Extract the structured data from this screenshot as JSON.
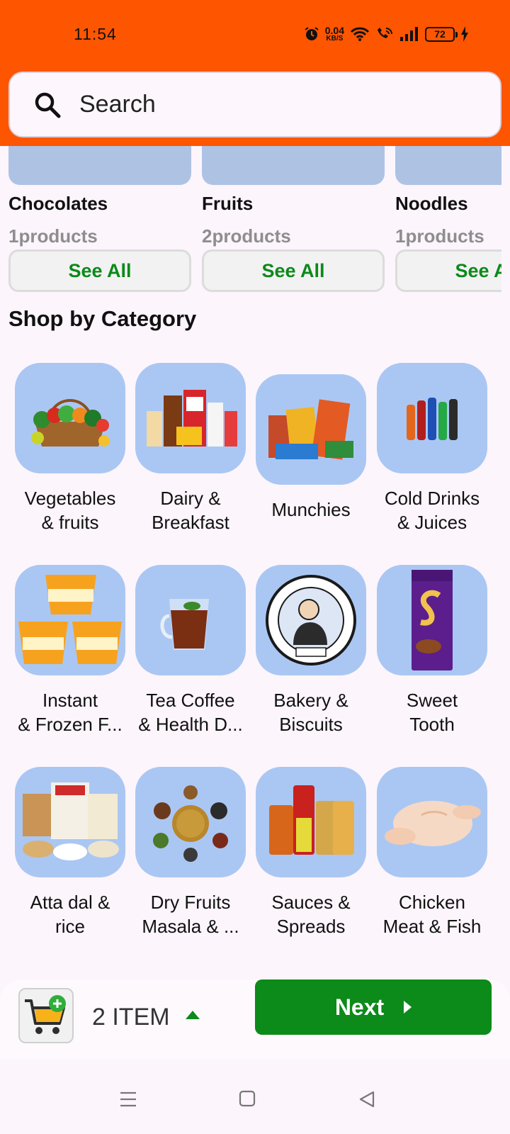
{
  "status_bar": {
    "time": "11:54",
    "net_speed_value": "0.04",
    "net_speed_unit": "KB/S",
    "battery": "72",
    "icons": [
      "alarm-icon",
      "wifi-icon",
      "wifi-call-icon",
      "signal-icon",
      "battery-icon",
      "charging-icon"
    ]
  },
  "search": {
    "placeholder": "Search"
  },
  "featured": [
    {
      "name": "Chocolates",
      "count": "1products",
      "action": "See All"
    },
    {
      "name": "Fruits",
      "count": "2products",
      "action": "See All"
    },
    {
      "name": "Noodles",
      "count": "1products",
      "action": "See All"
    }
  ],
  "section_title": "Shop by Category",
  "categories": [
    {
      "line1": "Vegetables",
      "line2": "& fruits",
      "icon": "vegetables-basket-icon"
    },
    {
      "line1": "Dairy &",
      "line2": "Breakfast",
      "icon": "dairy-products-icon"
    },
    {
      "line1": "Munchies",
      "line2": "",
      "icon": "snacks-icon"
    },
    {
      "line1": "Cold Drinks",
      "line2": "& Juices",
      "icon": "soft-drink-bottles-icon"
    },
    {
      "line1": "Instant",
      "line2": "& Frozen F...",
      "icon": "instant-noodle-cups-icon"
    },
    {
      "line1": "Tea Coffee",
      "line2": "& Health D...",
      "icon": "tea-cup-icon"
    },
    {
      "line1": "Bakery &",
      "line2": "Biscuits",
      "icon": "bakers-logo-icon"
    },
    {
      "line1": "Sweet",
      "line2": "Tooth",
      "icon": "chocolate-bar-icon"
    },
    {
      "line1": "Atta dal &",
      "line2": "rice",
      "icon": "atta-bags-icon"
    },
    {
      "line1": "Dry Fruits",
      "line2": "Masala & ...",
      "icon": "spices-icon"
    },
    {
      "line1": "Sauces &",
      "line2": "Spreads",
      "icon": "sauce-jars-icon"
    },
    {
      "line1": "Chicken",
      "line2": "Meat & Fish",
      "icon": "raw-chicken-icon"
    }
  ],
  "cart": {
    "count_label": "2 ITEM",
    "next_label": "Next"
  },
  "colors": {
    "header": "#fe5500",
    "accent": "#0c8a1a",
    "tile": "#aac7f3"
  }
}
